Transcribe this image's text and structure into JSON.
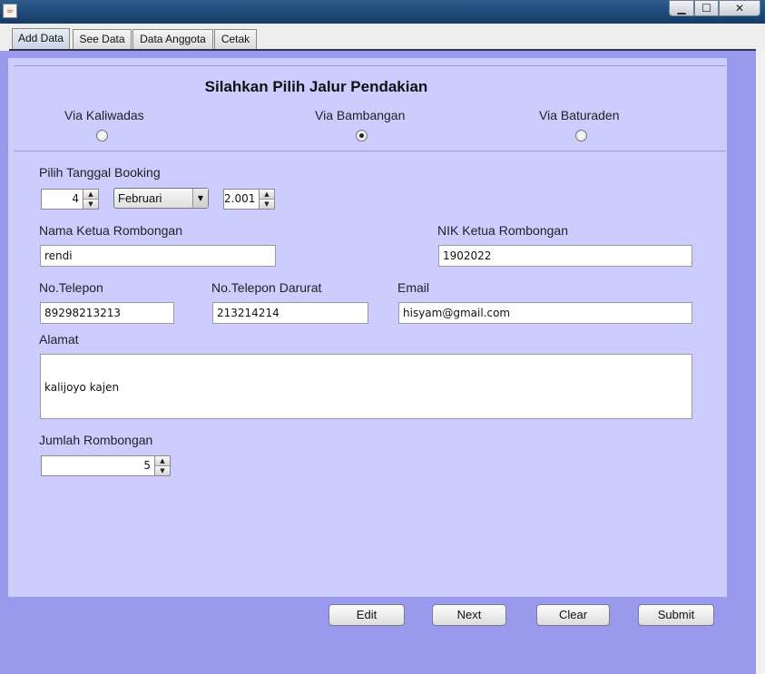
{
  "window": {
    "icon": "java-cup-icon",
    "controls": {
      "minimize": "▁",
      "maximize": "☐",
      "close": "✕"
    }
  },
  "tabs": [
    {
      "label": "Add Data",
      "active": true
    },
    {
      "label": "See Data",
      "active": false
    },
    {
      "label": "Data Anggota",
      "active": false
    },
    {
      "label": "Cetak",
      "active": false
    }
  ],
  "form": {
    "heading": "Silahkan Pilih Jalur Pendakian",
    "routes": [
      {
        "label": "Via Kaliwadas",
        "selected": false
      },
      {
        "label": "Via Bambangan",
        "selected": true
      },
      {
        "label": "Via Baturaden",
        "selected": false
      }
    ],
    "booking": {
      "label": "Pilih Tanggal Booking",
      "day": "4",
      "month": "Februari",
      "year": "2.001"
    },
    "leader_name": {
      "label": "Nama Ketua Rombongan",
      "value": "rendi"
    },
    "leader_nik": {
      "label": "NIK Ketua Rombongan",
      "value": "1902022"
    },
    "phone": {
      "label": "No.Telepon",
      "value": "89298213213"
    },
    "emergency_phone": {
      "label": "No.Telepon Darurat",
      "value": "213214214"
    },
    "email": {
      "label": "Email",
      "value": "hisyam@gmail.com"
    },
    "address": {
      "label": "Alamat",
      "value": "kalijoyo kajen"
    },
    "group_size": {
      "label": "Jumlah Rombongan",
      "value": "5"
    }
  },
  "buttons": {
    "edit": "Edit",
    "next": "Next",
    "clear": "Clear",
    "submit": "Submit"
  },
  "colors": {
    "panel_bg": "#9999ee",
    "form_bg": "#ccccff"
  }
}
